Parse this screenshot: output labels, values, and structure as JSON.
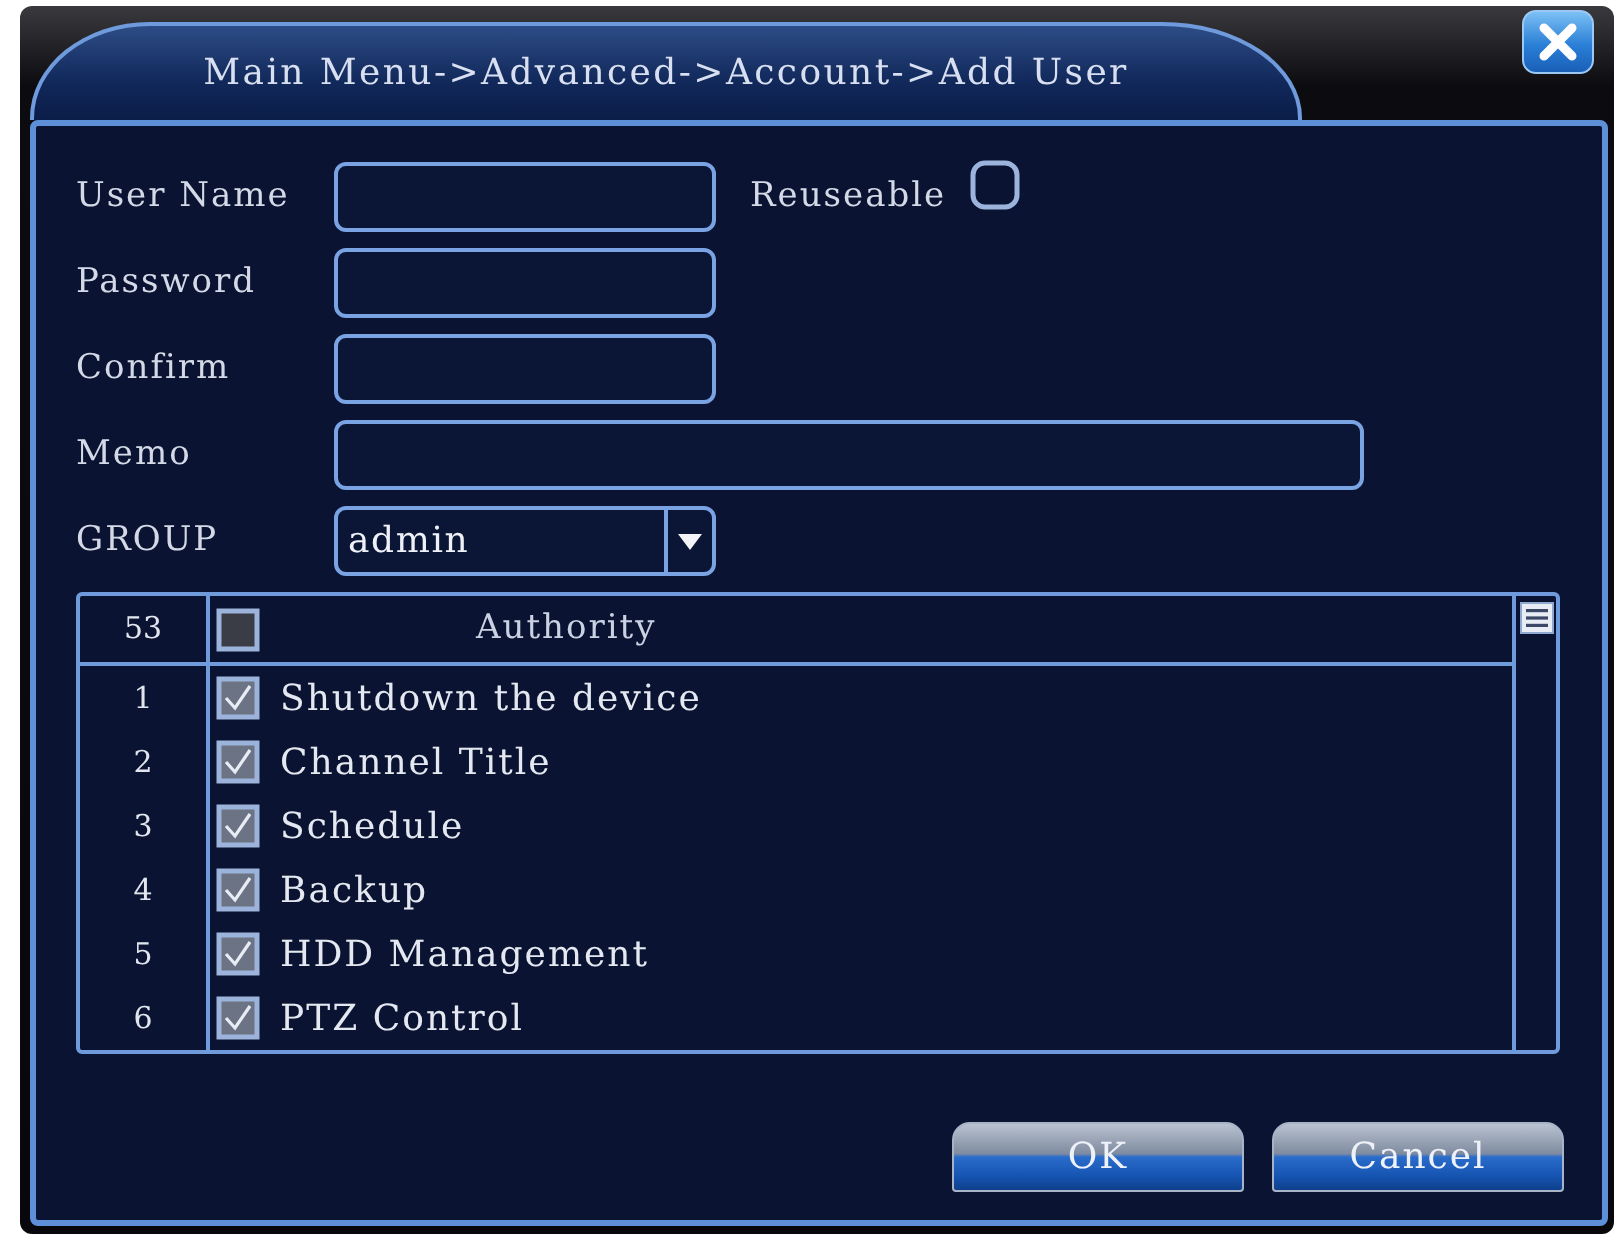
{
  "window": {
    "title": "Main Menu->Advanced->Account->Add User"
  },
  "form": {
    "fields": [
      {
        "label": "User Name",
        "kind": "text"
      },
      {
        "label": "Password",
        "kind": "text"
      },
      {
        "label": "Confirm",
        "kind": "text"
      },
      {
        "label": "Memo",
        "kind": "wide"
      },
      {
        "label": "GROUP",
        "kind": "select",
        "value": "admin"
      }
    ],
    "reuseable": {
      "label": "Reuseable",
      "checked": false
    }
  },
  "authority": {
    "count": "53",
    "select_all": {
      "checked": false
    },
    "column": "Authority",
    "rows": [
      {
        "number": "1",
        "label": "Shutdown the device",
        "checked": true
      },
      {
        "number": "2",
        "label": "Channel Title",
        "checked": true
      },
      {
        "number": "3",
        "label": "Schedule",
        "checked": true
      },
      {
        "number": "4",
        "label": "Backup",
        "checked": true
      },
      {
        "number": "5",
        "label": "HDD Management",
        "checked": true
      },
      {
        "number": "6",
        "label": "PTZ Control",
        "checked": true
      }
    ]
  },
  "buttons": [
    "OK",
    "Cancel"
  ]
}
